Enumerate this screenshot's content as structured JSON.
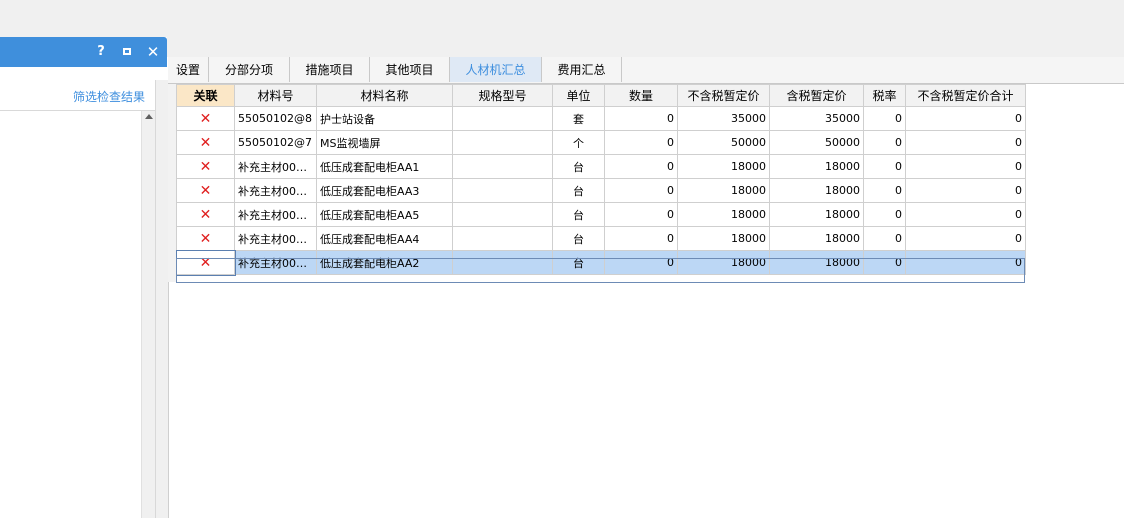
{
  "panel": {
    "controls": {
      "help": "?",
      "close": "✕"
    },
    "filter_link": "筛选检查结果"
  },
  "tabs": [
    {
      "label": "设置",
      "active": false
    },
    {
      "label": "分部分项",
      "active": false
    },
    {
      "label": "措施项目",
      "active": false
    },
    {
      "label": "其他项目",
      "active": false
    },
    {
      "label": "人材机汇总",
      "active": true
    },
    {
      "label": "费用汇总",
      "active": false
    }
  ],
  "table": {
    "columns": [
      "关联",
      "材料号",
      "材料名称",
      "规格型号",
      "单位",
      "数量",
      "不含税暂定价",
      "含税暂定价",
      "税率",
      "不含税暂定价合计"
    ],
    "link_icon": "✕",
    "rows": [
      {
        "code": "55050102@8",
        "name": "护士站设备",
        "spec": "",
        "unit": "套",
        "qty": "0",
        "price_ex": "35000",
        "price_in": "35000",
        "tax": "0",
        "total": "0"
      },
      {
        "code": "55050102@7",
        "name": "MS监视墙屏",
        "spec": "",
        "unit": "个",
        "qty": "0",
        "price_ex": "50000",
        "price_in": "50000",
        "tax": "0",
        "total": "0"
      },
      {
        "code": "补充主材00…",
        "name": "低压成套配电柜AA1",
        "spec": "",
        "unit": "台",
        "qty": "0",
        "price_ex": "18000",
        "price_in": "18000",
        "tax": "0",
        "total": "0"
      },
      {
        "code": "补充主材00…",
        "name": "低压成套配电柜AA3",
        "spec": "",
        "unit": "台",
        "qty": "0",
        "price_ex": "18000",
        "price_in": "18000",
        "tax": "0",
        "total": "0"
      },
      {
        "code": "补充主材00…",
        "name": "低压成套配电柜AA5",
        "spec": "",
        "unit": "台",
        "qty": "0",
        "price_ex": "18000",
        "price_in": "18000",
        "tax": "0",
        "total": "0"
      },
      {
        "code": "补充主材00…",
        "name": "低压成套配电柜AA4",
        "spec": "",
        "unit": "台",
        "qty": "0",
        "price_ex": "18000",
        "price_in": "18000",
        "tax": "0",
        "total": "0"
      },
      {
        "code": "补充主材00…",
        "name": "低压成套配电柜AA2",
        "spec": "",
        "unit": "台",
        "qty": "0",
        "price_ex": "18000",
        "price_in": "18000",
        "tax": "0",
        "total": "0"
      }
    ],
    "selected_row": 6
  },
  "colors": {
    "accent": "#3f8fdc",
    "link": "#3d8ede",
    "delete": "#e02020",
    "selection": "#bcd7f5"
  }
}
